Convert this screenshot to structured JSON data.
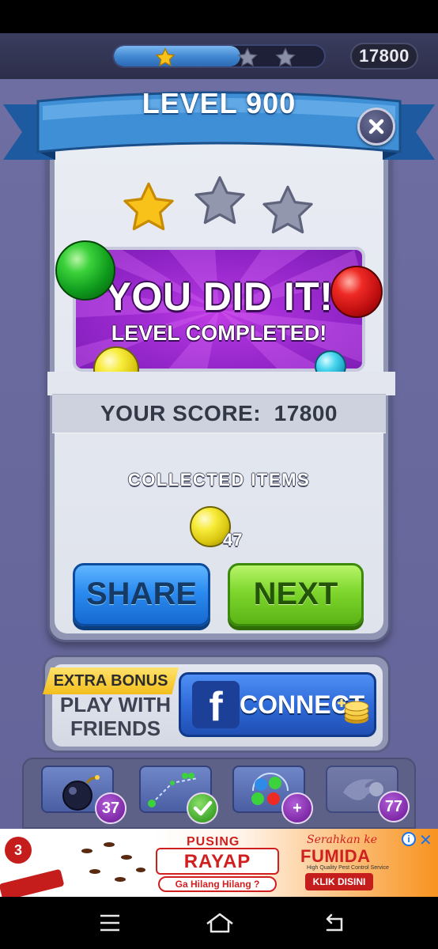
{
  "hud": {
    "score": "17800",
    "progress_stars_earned": 1,
    "progress_stars_total": 3,
    "progress_fill": 0.6
  },
  "dialog": {
    "title": "LEVEL 900",
    "stars_earned": 1,
    "stars_total": 3,
    "banner_title": "YOU DID IT!",
    "banner_subtitle": "LEVEL COMPLETED!",
    "score_label": "YOUR SCORE:",
    "score_value": "17800",
    "collected_label": "COLLECTED ITEMS",
    "collected_count": "47",
    "share_label": "SHARE",
    "next_label": "NEXT"
  },
  "bonus": {
    "tag": "EXTRA BONUS",
    "line1": "PLAY WITH",
    "line2": "FRIENDS",
    "connect_label": "CONNECT",
    "facebook_letter": "f"
  },
  "boosters": [
    {
      "icon": "bomb-icon",
      "badge": "37"
    },
    {
      "icon": "aim-line-icon",
      "badge": "check"
    },
    {
      "icon": "color-balls-icon",
      "badge": "+"
    },
    {
      "icon": "fireball-icon",
      "badge": "77"
    }
  ],
  "ad": {
    "badge": "3",
    "pusing": "PUSING",
    "rayap": "RAYAP",
    "ga_hilang": "Ga Hilang Hilang ?",
    "serahkan": "Serahkan ke",
    "fumida": "FUMIDA",
    "tagline": "High Quality Pest Control Service",
    "klik": "KLIK DISINI"
  },
  "colors": {
    "background": "#6a6a9e",
    "ribbon": "#3f8fd6",
    "banner_purple": "#a52fd6",
    "share_blue": "#2b8bf0",
    "next_green": "#7ed62d",
    "star_gold": "#f8c21a"
  }
}
